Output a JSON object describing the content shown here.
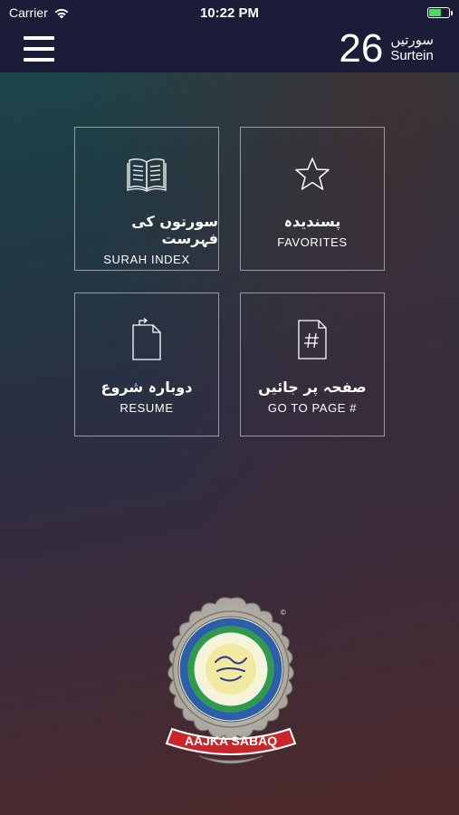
{
  "status_bar": {
    "carrier": "Carrier",
    "time": "10:22 PM",
    "battery_fraction": 0.6,
    "battery_color": "#4cd964"
  },
  "header": {
    "counter_value": "26",
    "counter_label_urdu": "سورتیں",
    "counter_label_en": "Surtein"
  },
  "menu": [
    {
      "urdu": "سورتوں کی فہرست",
      "en": "SURAH INDEX",
      "icon": "open-book-icon"
    },
    {
      "urdu": "پسندیدہ",
      "en": "FAVORITES",
      "icon": "star-icon"
    },
    {
      "urdu": "دوبارہ شروع",
      "en": "RESUME",
      "icon": "resume-document-icon"
    },
    {
      "urdu": "صفحہ پر جائیں",
      "en": "GO TO PAGE #",
      "icon": "hash-document-icon"
    }
  ],
  "logo": {
    "banner": "AAJKA SABAQ",
    "copyright": "©"
  },
  "colors": {
    "header_bg": "#1b1d38",
    "badge_red": "#c9252b",
    "ring_blue": "#2b5fa8",
    "ring_green": "#2f9a4a"
  }
}
